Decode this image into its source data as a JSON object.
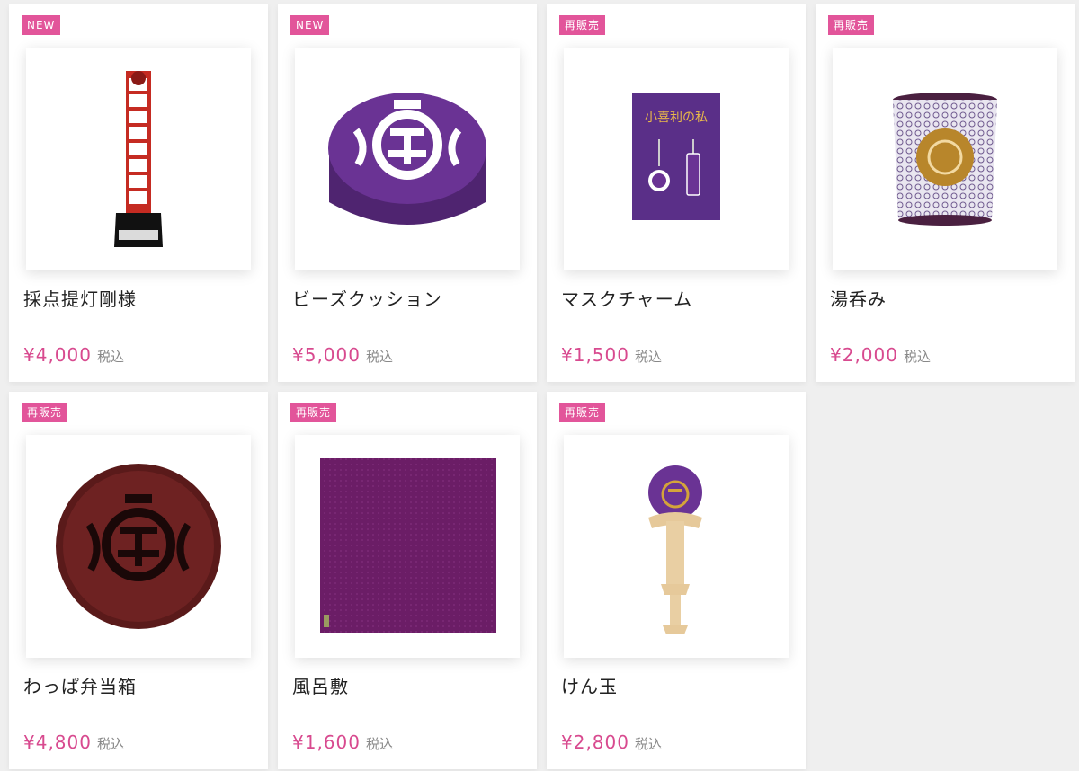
{
  "products": [
    {
      "badge": "NEW",
      "name": "採点提灯剛様",
      "price": "¥4,000",
      "tax": "税込",
      "image": "lantern-tower-stand"
    },
    {
      "badge": "NEW",
      "name": "ビーズクッション",
      "price": "¥5,000",
      "tax": "税込",
      "image": "purple-bead-cushion"
    },
    {
      "badge": "再販売",
      "name": "マスクチャーム",
      "price": "¥1,500",
      "tax": "税込",
      "image": "mask-charm-card",
      "image_text": "小喜利の私"
    },
    {
      "badge": "再販売",
      "name": "湯呑み",
      "price": "¥2,000",
      "tax": "税込",
      "image": "patterned-teacup"
    },
    {
      "badge": "再販売",
      "name": "わっぱ弁当箱",
      "price": "¥4,800",
      "tax": "税込",
      "image": "round-lacquer-bento"
    },
    {
      "badge": "再販売",
      "name": "風呂敷",
      "price": "¥1,600",
      "tax": "税込",
      "image": "purple-furoshiki"
    },
    {
      "badge": "再販売",
      "name": "けん玉",
      "price": "¥2,800",
      "tax": "税込",
      "image": "purple-kendama"
    }
  ],
  "colors": {
    "badge": "#e2559a",
    "price": "#d84a8f",
    "purple": "#6a3394",
    "background": "#efefef"
  }
}
